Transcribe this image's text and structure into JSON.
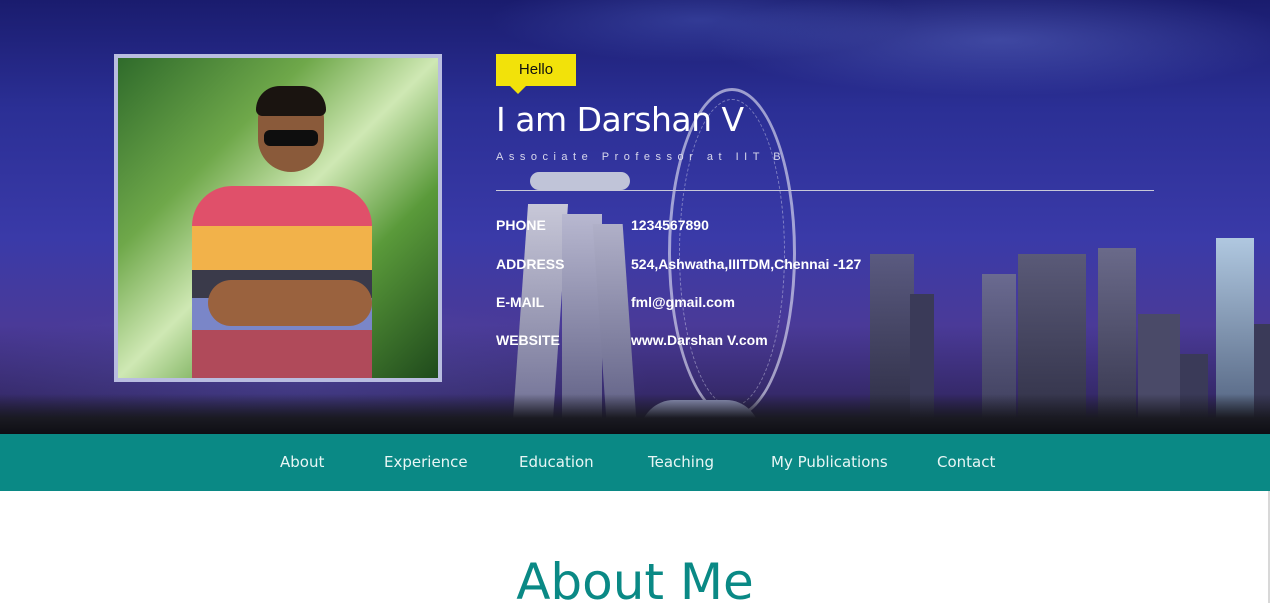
{
  "hero": {
    "hello": "Hello",
    "name": "I am Darshan V",
    "subtitle": "Associate Professor at IIT B",
    "info": [
      {
        "label": "PHONE",
        "value": "1234567890"
      },
      {
        "label": "ADDRESS",
        "value": "524,Ashwatha,IIITDM,Chennai -127"
      },
      {
        "label": "E-MAIL",
        "value": "fml@gmail.com"
      },
      {
        "label": "WEBSITE",
        "value": "www.Darshan V.com"
      }
    ]
  },
  "nav": {
    "items": [
      "About",
      "Experience",
      "Education",
      "Teaching",
      "My Publications",
      "Contact"
    ]
  },
  "about": {
    "title": "About Me"
  },
  "colors": {
    "accent": "#0a8985",
    "hello_badge": "#f2e20a"
  }
}
